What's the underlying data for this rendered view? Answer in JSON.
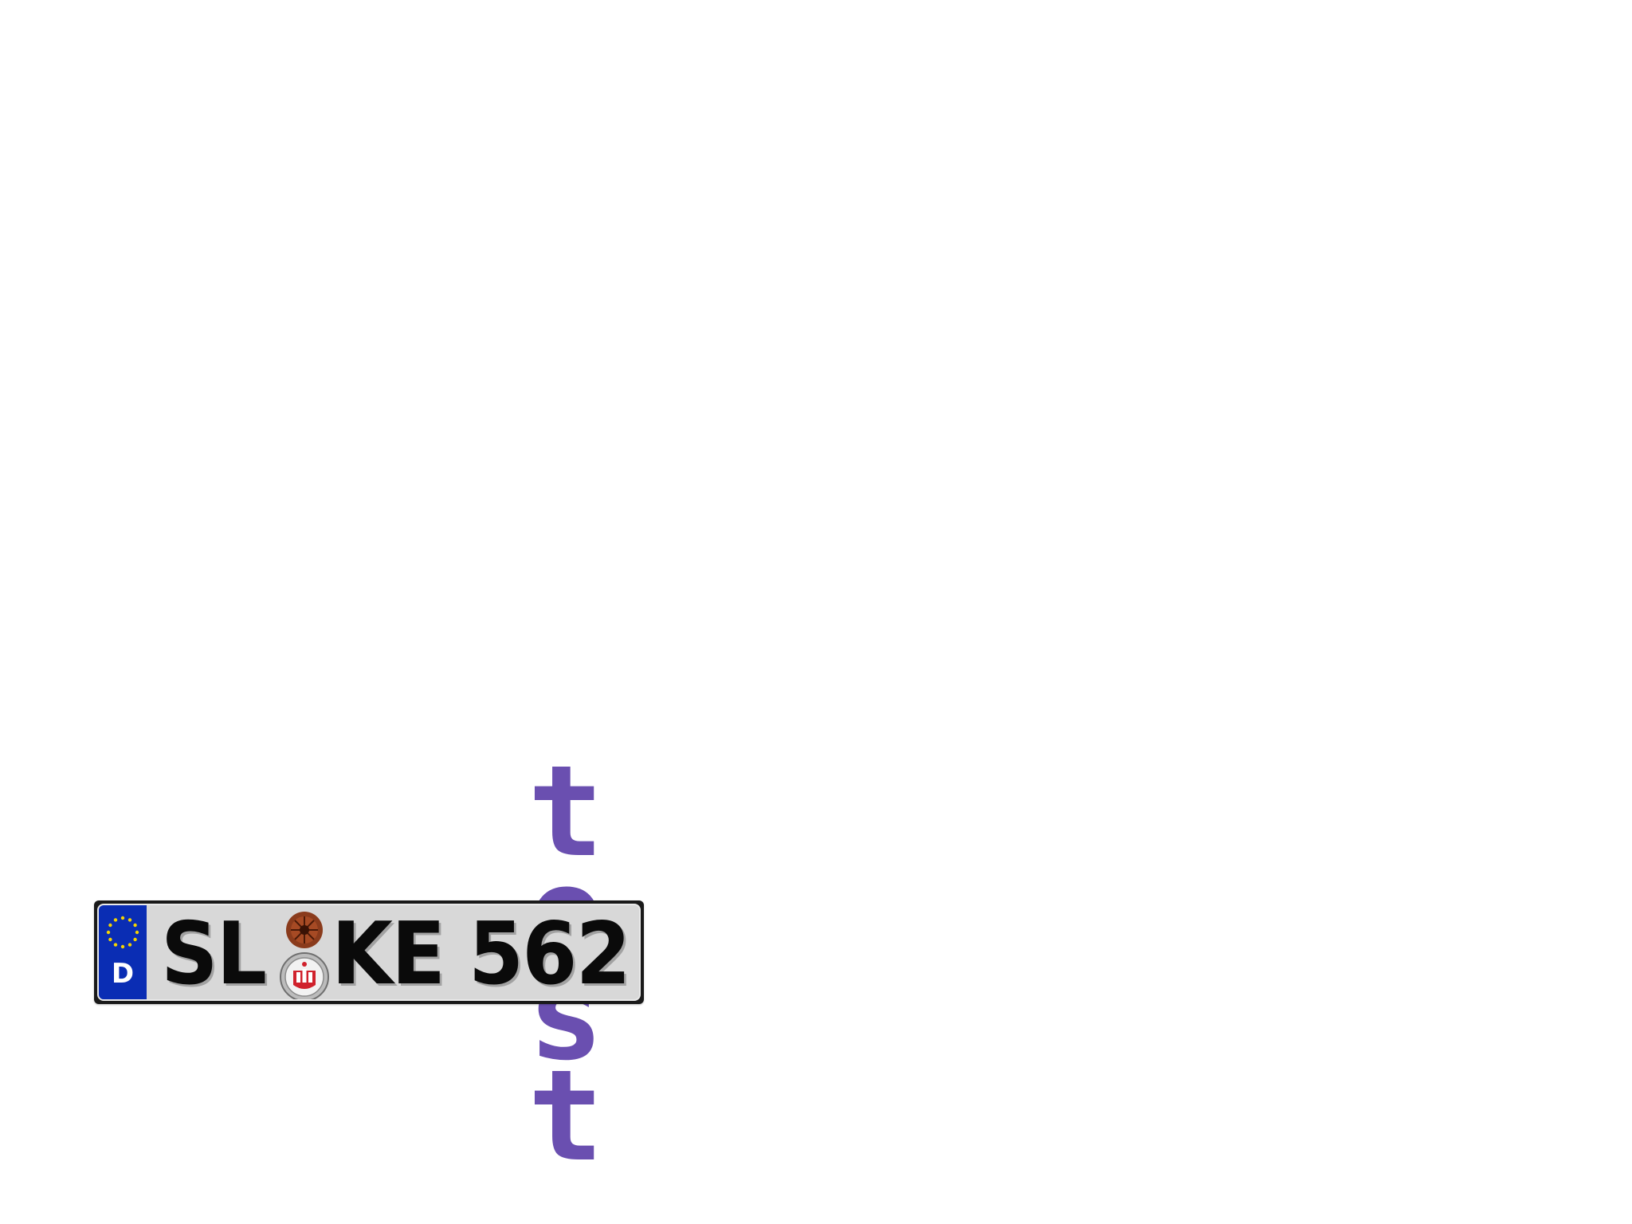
{
  "vertical_text": {
    "letters": [
      "t",
      "e",
      "s",
      "t"
    ],
    "color": "#6a4fb0"
  },
  "license_plate": {
    "country_code": "D",
    "city_code": "SL",
    "letters": "KE",
    "digits": "562",
    "eu_band_color": "#0a2db4",
    "plate_background": "#d8d8d8",
    "text_color": "#0a0a0a",
    "icons": [
      "eu-stars-icon",
      "inspection-sticker-icon",
      "state-seal-icon"
    ]
  }
}
